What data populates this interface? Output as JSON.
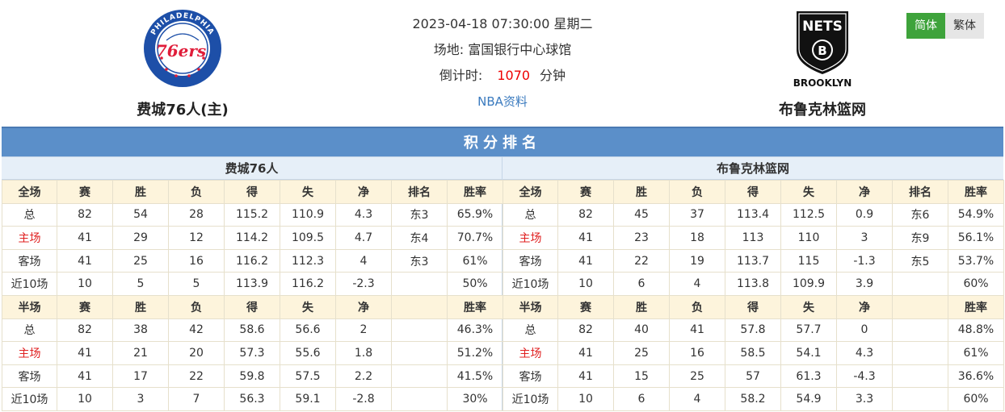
{
  "match": {
    "datetime": "2023-04-18 07:30:00 星期二",
    "venue": "场地:  富国银行中心球馆",
    "countdown_label": "倒计时:",
    "countdown_value": "1070",
    "countdown_unit": "分钟",
    "nba_link": "NBA资料"
  },
  "home_team": {
    "name": "费城76人(主)",
    "logo_text": "76ers",
    "logo_ring_text": "PHILADELPHIA"
  },
  "away_team": {
    "name": "布鲁克林篮网",
    "logo_top_text": "NETS",
    "logo_bottom_text": "BROOKLYN",
    "logo_letter": "B"
  },
  "lang": {
    "simplified": "简体",
    "traditional": "繁体"
  },
  "standings": {
    "title": "积分排名",
    "colors": {
      "title_bg": "#5b8fc9",
      "header_bg": "#fdf4dc",
      "team_bg": "#e6eff8",
      "home_red": "#e02020"
    },
    "teams": [
      {
        "name": "费城76人",
        "full_header": [
          "全场",
          "赛",
          "胜",
          "负",
          "得",
          "失",
          "净",
          "排名",
          "胜率"
        ],
        "full_rows": [
          [
            "总",
            "82",
            "54",
            "28",
            "115.2",
            "110.9",
            "4.3",
            "东3",
            "65.9%"
          ],
          [
            "主场",
            "41",
            "29",
            "12",
            "114.2",
            "109.5",
            "4.7",
            "东4",
            "70.7%"
          ],
          [
            "客场",
            "41",
            "25",
            "16",
            "116.2",
            "112.3",
            "4",
            "东3",
            "61%"
          ],
          [
            "近10场",
            "10",
            "5",
            "5",
            "113.9",
            "116.2",
            "-2.3",
            "",
            "50%"
          ]
        ],
        "half_header": [
          "半场",
          "赛",
          "胜",
          "负",
          "得",
          "失",
          "净",
          "",
          "胜率"
        ],
        "half_rows": [
          [
            "总",
            "82",
            "38",
            "42",
            "58.6",
            "56.6",
            "2",
            "",
            "46.3%"
          ],
          [
            "主场",
            "41",
            "21",
            "20",
            "57.3",
            "55.6",
            "1.8",
            "",
            "51.2%"
          ],
          [
            "客场",
            "41",
            "17",
            "22",
            "59.8",
            "57.5",
            "2.2",
            "",
            "41.5%"
          ],
          [
            "近10场",
            "10",
            "3",
            "7",
            "56.3",
            "59.1",
            "-2.8",
            "",
            "30%"
          ]
        ]
      },
      {
        "name": "布鲁克林篮网",
        "full_header": [
          "全场",
          "赛",
          "胜",
          "负",
          "得",
          "失",
          "净",
          "排名",
          "胜率"
        ],
        "full_rows": [
          [
            "总",
            "82",
            "45",
            "37",
            "113.4",
            "112.5",
            "0.9",
            "东6",
            "54.9%"
          ],
          [
            "主场",
            "41",
            "23",
            "18",
            "113",
            "110",
            "3",
            "东9",
            "56.1%"
          ],
          [
            "客场",
            "41",
            "22",
            "19",
            "113.7",
            "115",
            "-1.3",
            "东5",
            "53.7%"
          ],
          [
            "近10场",
            "10",
            "6",
            "4",
            "113.8",
            "109.9",
            "3.9",
            "",
            "60%"
          ]
        ],
        "half_header": [
          "半场",
          "赛",
          "胜",
          "负",
          "得",
          "失",
          "净",
          "",
          "胜率"
        ],
        "half_rows": [
          [
            "总",
            "82",
            "40",
            "41",
            "57.8",
            "57.7",
            "0",
            "",
            "48.8%"
          ],
          [
            "主场",
            "41",
            "25",
            "16",
            "58.5",
            "54.1",
            "4.3",
            "",
            "61%"
          ],
          [
            "客场",
            "41",
            "15",
            "25",
            "57",
            "61.3",
            "-4.3",
            "",
            "36.6%"
          ],
          [
            "近10场",
            "10",
            "6",
            "4",
            "58.2",
            "54.9",
            "3.3",
            "",
            "60%"
          ]
        ]
      }
    ]
  }
}
